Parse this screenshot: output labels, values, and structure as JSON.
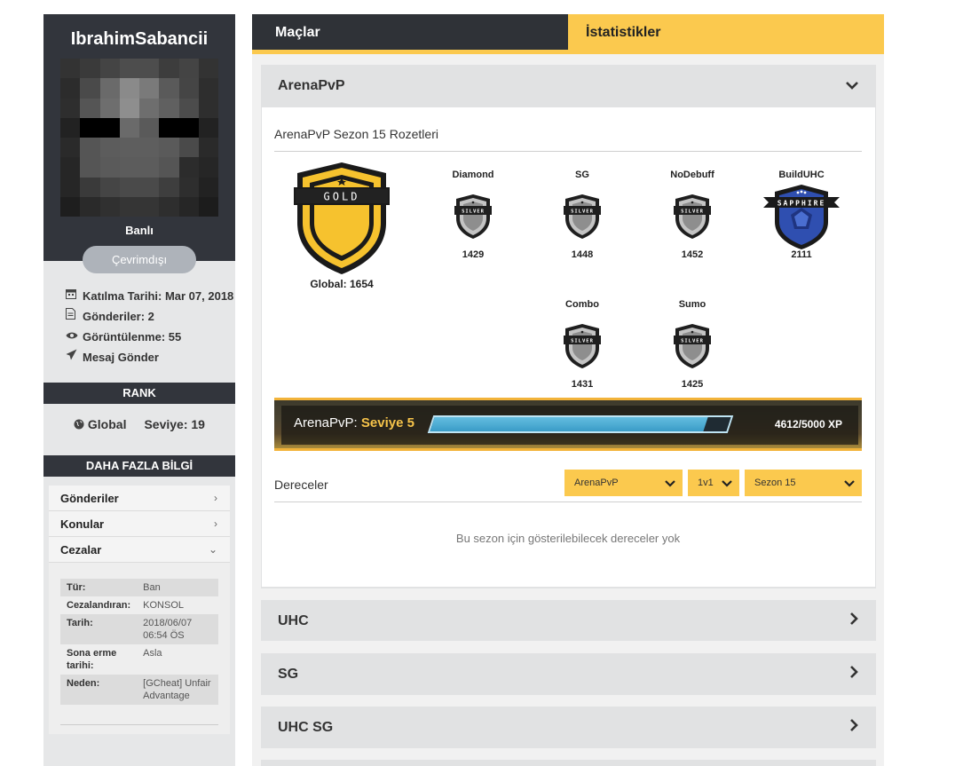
{
  "profile": {
    "username": "IbrahimSabancii",
    "status": "Banlı",
    "online_state": "Çevrimdışı",
    "joined": "Katılma Tarihi: Mar 07, 2018",
    "posts": "Gönderiler: 2",
    "views": "Görüntülenme: 55",
    "message": "Mesaj Gönder"
  },
  "rank": {
    "title": "RANK",
    "scope": "Global",
    "level": "Seviye: 19"
  },
  "more_info": {
    "title": "DAHA FAZLA BİLGİ",
    "items": [
      {
        "label": "Gönderiler"
      },
      {
        "label": "Konular"
      },
      {
        "label": "Cezalar"
      }
    ],
    "penalty": {
      "type_key": "Tür:",
      "type_val": "Ban",
      "by_key": "Cezalandıran:",
      "by_val": "KONSOL",
      "date_key": "Tarih:",
      "date_val": "2018/06/07 06:54 ÖS",
      "expire_key": "Sona erme tarihi:",
      "expire_val": "Asla",
      "reason_key": "Neden:",
      "reason_val": "[GCheat] Unfair Advantage"
    }
  },
  "tabs": {
    "matches": "Maçlar",
    "stats": "İstatistikler"
  },
  "arena": {
    "title": "ArenaPvP",
    "badge_title": "ArenaPvP Sezon 15 Rozetleri",
    "global_badge": "GOLD",
    "global_label": "Global: 1654",
    "modes": [
      {
        "name": "Diamond",
        "badge": "SILVER",
        "score": "1429"
      },
      {
        "name": "SG",
        "badge": "SILVER",
        "score": "1448"
      },
      {
        "name": "NoDebuff",
        "badge": "SILVER",
        "score": "1452"
      },
      {
        "name": "BuildUHC",
        "badge": "SAPPHIRE",
        "score": "2111"
      },
      {
        "name": "Combo",
        "badge": "SILVER",
        "score": "1431"
      },
      {
        "name": "Sumo",
        "badge": "SILVER",
        "score": "1425"
      }
    ],
    "xp": {
      "label": "ArenaPvP: ",
      "level": "Seviye 5",
      "value": "4612/5000 XP",
      "progress": 0.9224
    },
    "ratings": {
      "title": "Dereceler",
      "mode_select": "ArenaPvP",
      "type_select": "1v1",
      "season_select": "Sezon 15",
      "empty": "Bu sezon için gösterilebilecek dereceler yok"
    }
  },
  "sections": {
    "uhc": "UHC",
    "sg": "SG",
    "uhcsg": "UHC SG"
  },
  "colors": {
    "dark": "#32353c",
    "accent": "#fbc94e",
    "panel": "#e6e7e8"
  }
}
